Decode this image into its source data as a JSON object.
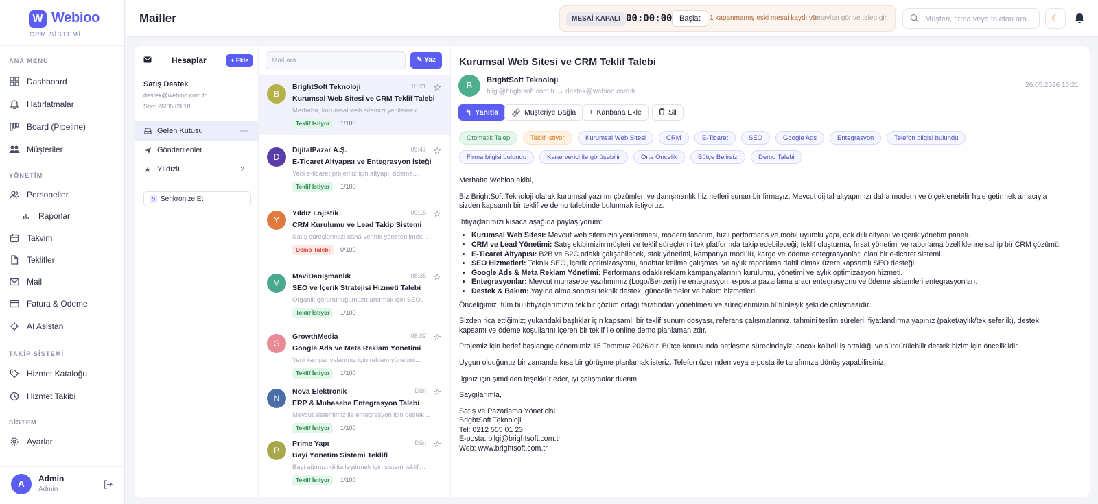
{
  "brand": {
    "logo_letter": "W",
    "name": "Webioo",
    "sub": "CRM SİSTEMİ"
  },
  "sidebar": {
    "sections": [
      {
        "title": "ANA MENÜ"
      },
      {
        "title": "YÖNETİM"
      },
      {
        "title": "TAKİP SİSTEMİ"
      },
      {
        "title": "SİSTEM"
      }
    ],
    "items": [
      {
        "label": "Dashboard",
        "icon": "grid-icon"
      },
      {
        "label": "Hatırlatmalar",
        "icon": "bell-icon"
      },
      {
        "label": "Board (Pipeline)",
        "icon": "board-icon"
      },
      {
        "label": "Müşteriler",
        "icon": "users-icon"
      },
      {
        "label": "Personeller",
        "icon": "user-icon"
      },
      {
        "label": "Raporlar",
        "icon": "chart-icon"
      },
      {
        "label": "Takvim",
        "icon": "calendar-icon"
      },
      {
        "label": "Teklifler",
        "icon": "file-icon"
      },
      {
        "label": "Mail",
        "icon": "mail-icon"
      },
      {
        "label": "Fatura & Ödeme",
        "icon": "card-icon"
      },
      {
        "label": "AI Asistan",
        "icon": "ai-icon"
      },
      {
        "label": "Hizmet Kataloğu",
        "icon": "tag-icon"
      },
      {
        "label": "Hizmet Takibi",
        "icon": "clock-icon"
      },
      {
        "label": "Ayarlar",
        "icon": "gear-icon"
      }
    ],
    "user": {
      "initial": "A",
      "name": "Admin",
      "role": "Admin"
    }
  },
  "topbar": {
    "title": "Mailler",
    "shift": {
      "status": "MESAİ KAPALI",
      "timer": "00:00:00",
      "start_label": "Başlat",
      "link": "1 kapanmamış eski mesai kaydı var.",
      "note": "Detayları gör ve talep gir."
    },
    "search_placeholder": "Müşteri, firma veya telefon ara..."
  },
  "accounts": {
    "title": "Hesaplar",
    "add_label": "+ Ekle",
    "account": {
      "name": "Satış Destek",
      "email": "destek@webioo.com.tr",
      "last": "Son: 26/05 09:18"
    },
    "folders": [
      {
        "label": "Gelen Kutusu",
        "count": ""
      },
      {
        "label": "Gönderilenler",
        "count": ""
      },
      {
        "label": "Yıldızlı",
        "count": "2"
      }
    ],
    "sync_label": "Senkronize Et"
  },
  "mail_list": {
    "search_placeholder": "Mail ara...",
    "write_label": "Yaz",
    "items": [
      {
        "initial": "B",
        "color": "#b5b24a",
        "from": "BrightSoft Teknoloji",
        "time": "10:21",
        "subject": "Kurumsal Web Sitesi ve CRM Teklif Talebi",
        "preview": "Merhaba, kurumsal web sitemizi yenilemek...",
        "tag": "Teklif İstiyor",
        "tag_type": "green",
        "score": "1/100"
      },
      {
        "initial": "D",
        "color": "#5a3ea8",
        "from": "DijitalPazar A.Ş.",
        "time": "09:47",
        "subject": "E-Ticaret Altyapısı ve Entegrasyon İsteği",
        "preview": "Yeni e-ticaret projemiz için altyapı, ödeme...",
        "tag": "Teklif İstiyor",
        "tag_type": "green",
        "score": "1/100"
      },
      {
        "initial": "Y",
        "color": "#e07a3f",
        "from": "Yıldız Lojistik",
        "time": "09:15",
        "subject": "CRM Kurulumu ve Lead Takip Sistemi",
        "preview": "Satış süreçlerimizi daha verimli yönetebilmek...",
        "tag": "Demo Talebi",
        "tag_type": "red",
        "score": "0/100"
      },
      {
        "initial": "M",
        "color": "#4aa88e",
        "from": "MaviDanışmanlık",
        "time": "08:35",
        "subject": "SEO ve İçerik Stratejisi Hizmeti Talebi",
        "preview": "Organik görünürlüğümüzü artırmak için SEO...",
        "tag": "Teklif İstiyor",
        "tag_type": "green",
        "score": "1/100"
      },
      {
        "initial": "G",
        "color": "#e88a94",
        "from": "GrowthMedia",
        "time": "08:02",
        "subject": "Google Ads ve Meta Reklam Yönetimi",
        "preview": "Yeni kampanyalarımız için reklam yönetimi...",
        "tag": "Teklif İstiyor",
        "tag_type": "green",
        "score": "1/100"
      },
      {
        "initial": "N",
        "color": "#4a6ea8",
        "from": "Nova Elektronik",
        "time": "Dün",
        "subject": "ERP & Muhasebe Entegrasyon Talebi",
        "preview": "Mevcut sistemimiz ile entegrasyon için destek...",
        "tag": "Teklif İstiyor",
        "tag_type": "green",
        "score": "1/100"
      },
      {
        "initial": "P",
        "color": "#a8a84a",
        "from": "Prime Yapı",
        "time": "Dün",
        "subject": "Bayi Yönetim Sistemi Teklifi",
        "preview": "Bayi ağımızı dijitalleştirmek için sistem teklifi...",
        "tag": "Teklif İstiyor",
        "tag_type": "green",
        "score": "1/100"
      }
    ]
  },
  "detail": {
    "title": "Kurumsal Web Sitesi ve CRM Teklif Talebi",
    "initial": "B",
    "from": "BrightSoft Teknoloji",
    "addresses": "bilgi@brightsoft.com.tr → destek@webioo.com.tr",
    "date": "26.05.2026 10:21",
    "actions": {
      "reply": "Yanıtla",
      "link_customer": "Müşteriye Bağla",
      "kanban": "Kanbana Ekle",
      "delete": "Sil"
    },
    "tags_row1": [
      {
        "label": "Otomatik Talep",
        "type": "g"
      },
      {
        "label": "Teklif İstiyor",
        "type": "o"
      },
      {
        "label": "Kurumsal Web Sitesi",
        "type": "b"
      },
      {
        "label": "CRM",
        "type": "b"
      },
      {
        "label": "E-Ticaret",
        "type": "b"
      },
      {
        "label": "SEO",
        "type": "b"
      },
      {
        "label": "Google Ads",
        "type": "b"
      },
      {
        "label": "Entegrasyon",
        "type": "b"
      },
      {
        "label": "Telefon bilgisi bulundu",
        "type": "b"
      }
    ],
    "tags_row2": [
      {
        "label": "Firma bilgisi bulundu",
        "type": "b"
      },
      {
        "label": "Karar verici ile görüşebilir",
        "type": "b"
      },
      {
        "label": "Orta Öncelik",
        "type": "b"
      },
      {
        "label": "Bütçe Belirsiz",
        "type": "b"
      },
      {
        "label": "Demo Talebi",
        "type": "b"
      }
    ],
    "body": {
      "greeting": "Merhaba Webioo ekibi,",
      "p1": "Biz BrightSoft Teknoloji olarak kurumsal yazılım çözümleri ve danışmanlık hizmetleri sunan bir firmayız. Mevcut dijital altyapımızı daha modern ve ölçeklenebilir hale getirmek amacıyla sizden kapsamlı bir teklif ve demo talebinde bulunmak istiyoruz.",
      "p2": "İhtiyaçlarımızı kısaca aşağıda paylaşıyorum:",
      "list": [
        {
          "key": "Kurumsal Web Sitesi:",
          "text": " Mevcut web sitemizin yenilenmesi, modern tasarım, hızlı performans ve mobil uyumlu yapı, çok dilli altyapı ve içerik yönetim paneli."
        },
        {
          "key": "CRM ve Lead Yönetimi:",
          "text": " Satış ekibimizin müşteri ve teklif süreçlerini tek platformda takip edebileceği, teklif oluşturma, fırsat yönetimi ve raporlama özelliklerine sahip bir CRM çözümü."
        },
        {
          "key": "E-Ticaret Altyapısı:",
          "text": " B2B ve B2C odaklı çalışabilecek, stok yönetimi, kampanya modülü, kargo ve ödeme entegrasyonları olan bir e-ticaret sistemi."
        },
        {
          "key": "SEO Hizmetleri:",
          "text": " Teknik SEO, içerik optimizasyonu, anahtar kelime çalışması ve aylık raporlama dahil olmak üzere kapsamlı SEO desteği."
        },
        {
          "key": "Google Ads & Meta Reklam Yönetimi:",
          "text": " Performans odaklı reklam kampanyalarının kurulumu, yönetimi ve aylık optimizasyon hizmeti."
        },
        {
          "key": "Entegrasyonlar:",
          "text": " Mevcut muhasebe yazılımımız (Logo/Benzeri) ile entegrasyon, e-posta pazarlama aracı entegrasyonu ve ödeme sistemleri entegrasyonları."
        },
        {
          "key": "Destek & Bakım:",
          "text": " Yayına alma sonrası teknik destek, güncellemeler ve bakım hizmetleri."
        }
      ],
      "p3": "Önceliğimiz, tüm bu ihtiyaçlarımızın tek bir çözüm ortağı tarafından yönetilmesi ve süreçlerimizin bütünleşik şekilde çalışmasıdır.",
      "p4": "Sizden rica ettiğimiz; yukarıdaki başlıklar için kapsamlı bir teklif sunum dosyası, referans çalışmalarınız, tahmini teslim süreleri, fiyatlandırma yapınız (paket/aylık/tek seferlik), destek kapsamı ve ödeme koşullarını içeren bir teklif ile online demo planlamanızdır.",
      "p5": "Projemiz için hedef başlangıç dönemimiz 15 Temmuz 2026'dır. Bütçe konusunda netleşme sürecindeyiz; ancak kaliteli iş ortaklığı ve sürdürülebilir destek bizim için önceliklidir.",
      "p6": "Uygun olduğunuz bir zamanda kısa bir görüşme planlamak isteriz. Telefon üzerinden veya e-posta ile tarafımıza dönüş yapabilirsiniz.",
      "p7": "İlginiz için şimdiden teşekkür eder, iyi çalışmalar dilerim.",
      "closing": "Saygılarımla,",
      "sig": [
        "Satış ve Pazarlama Yöneticisi",
        "BrightSoft Teknoloji",
        "Tel: 0212 555 01 23",
        "E-posta: bilgi@brightsoft.com.tr",
        "Web: www.brightsoft.com.tr"
      ]
    }
  }
}
